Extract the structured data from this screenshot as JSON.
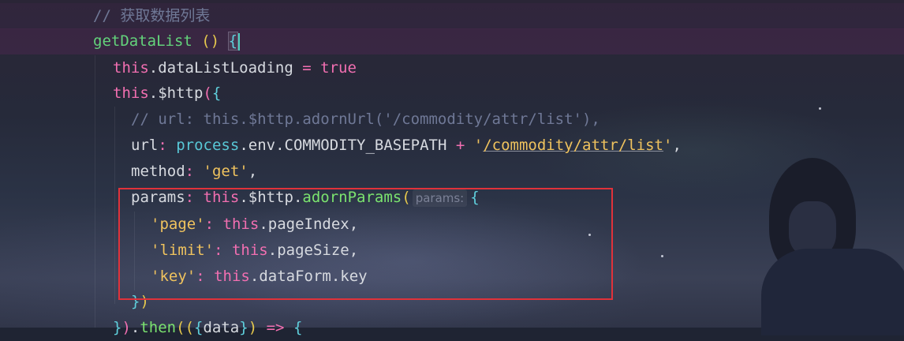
{
  "editor": {
    "lines": [
      {
        "parts": [
          {
            "cls": "c-comment",
            "text": "// 获取数据列表"
          }
        ]
      },
      {
        "parts": [
          {
            "cls": "c-fn",
            "text": "getDataList"
          },
          {
            "cls": "c-plain",
            "text": " "
          },
          {
            "cls": "c-paren",
            "text": "()"
          },
          {
            "cls": "c-plain",
            "text": " "
          },
          {
            "cls": "c-brace brace-hl",
            "text": "{"
          }
        ]
      },
      {
        "parts": [
          {
            "cls": "c-kw",
            "text": "this"
          },
          {
            "cls": "c-plain",
            "text": ".dataListLoading "
          },
          {
            "cls": "c-kw",
            "text": "="
          },
          {
            "cls": "c-plain",
            "text": " "
          },
          {
            "cls": "c-kw",
            "text": "true"
          }
        ]
      },
      {
        "parts": [
          {
            "cls": "c-kw",
            "text": "this"
          },
          {
            "cls": "c-plain",
            "text": ".$http"
          },
          {
            "cls": "c-kw",
            "text": "("
          },
          {
            "cls": "c-brace",
            "text": "{"
          }
        ]
      },
      {
        "parts": [
          {
            "cls": "c-comment",
            "text": "// url: this.$http.adornUrl('/commodity/attr/list'),"
          }
        ]
      },
      {
        "parts": [
          {
            "cls": "c-plain",
            "text": "url"
          },
          {
            "cls": "c-kw",
            "text": ":"
          },
          {
            "cls": "c-plain",
            "text": " "
          },
          {
            "cls": "c-prop",
            "text": "process"
          },
          {
            "cls": "c-plain",
            "text": ".env.COMMODITY_BASEPATH "
          },
          {
            "cls": "c-kw",
            "text": "+"
          },
          {
            "cls": "c-plain",
            "text": " "
          },
          {
            "cls": "c-str",
            "text": "'"
          },
          {
            "cls": "c-str ul",
            "text": "/commodity/attr/list"
          },
          {
            "cls": "c-str",
            "text": "'"
          },
          {
            "cls": "c-plain",
            "text": ","
          }
        ]
      },
      {
        "parts": [
          {
            "cls": "c-plain",
            "text": "method"
          },
          {
            "cls": "c-kw",
            "text": ":"
          },
          {
            "cls": "c-plain",
            "text": " "
          },
          {
            "cls": "c-str",
            "text": "'get'"
          },
          {
            "cls": "c-plain",
            "text": ","
          }
        ]
      },
      {
        "parts": [
          {
            "cls": "c-plain",
            "text": "params"
          },
          {
            "cls": "c-kw",
            "text": ":"
          },
          {
            "cls": "c-plain",
            "text": " "
          },
          {
            "cls": "c-kw",
            "text": "this"
          },
          {
            "cls": "c-plain",
            "text": ".$http."
          },
          {
            "cls": "c-green",
            "text": "adornParams"
          },
          {
            "cls": "c-paren",
            "text": "("
          },
          {
            "cls": "hint",
            "text": "params:"
          },
          {
            "cls": "c-brace",
            "text": "{"
          }
        ]
      },
      {
        "parts": [
          {
            "cls": "c-str",
            "text": "'page'"
          },
          {
            "cls": "c-kw",
            "text": ":"
          },
          {
            "cls": "c-plain",
            "text": " "
          },
          {
            "cls": "c-kw",
            "text": "this"
          },
          {
            "cls": "c-plain",
            "text": ".pageIndex,"
          }
        ]
      },
      {
        "parts": [
          {
            "cls": "c-str",
            "text": "'limit'"
          },
          {
            "cls": "c-kw",
            "text": ":"
          },
          {
            "cls": "c-plain",
            "text": " "
          },
          {
            "cls": "c-kw",
            "text": "this"
          },
          {
            "cls": "c-plain",
            "text": ".pageSize,"
          }
        ]
      },
      {
        "parts": [
          {
            "cls": "c-str",
            "text": "'key'"
          },
          {
            "cls": "c-kw",
            "text": ":"
          },
          {
            "cls": "c-plain",
            "text": " "
          },
          {
            "cls": "c-kw",
            "text": "this"
          },
          {
            "cls": "c-plain",
            "text": ".dataForm.key"
          }
        ]
      },
      {
        "parts": [
          {
            "cls": "c-brace",
            "text": "}"
          },
          {
            "cls": "c-paren",
            "text": ")"
          }
        ]
      },
      {
        "parts": [
          {
            "cls": "c-brace",
            "text": "}"
          },
          {
            "cls": "c-kw",
            "text": ")"
          },
          {
            "cls": "c-plain",
            "text": "."
          },
          {
            "cls": "c-green",
            "text": "then"
          },
          {
            "cls": "c-paren",
            "text": "("
          },
          {
            "cls": "c-paren",
            "text": "("
          },
          {
            "cls": "c-brace",
            "text": "{"
          },
          {
            "cls": "c-plain",
            "text": "data"
          },
          {
            "cls": "c-brace",
            "text": "}"
          },
          {
            "cls": "c-paren",
            "text": ")"
          },
          {
            "cls": "c-plain",
            "text": " "
          },
          {
            "cls": "c-kw",
            "text": "=>"
          },
          {
            "cls": "c-plain",
            "text": " "
          },
          {
            "cls": "c-brace",
            "text": "{"
          }
        ]
      }
    ]
  },
  "colors": {
    "highlight_box": "#e0323a",
    "current_line_band": "#5a285a"
  }
}
